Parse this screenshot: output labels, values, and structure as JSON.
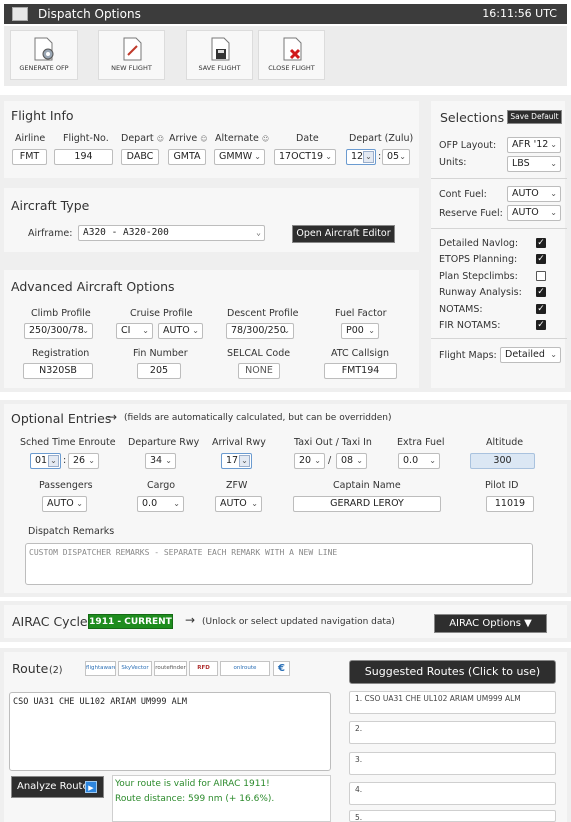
{
  "titlebar": {
    "title": "Dispatch Options",
    "time": "16:11:56 UTC"
  },
  "toolbar": {
    "generate_ofp": "GENERATE OFP",
    "new_flight": "NEW FLIGHT",
    "save_flight": "SAVE FLIGHT",
    "close_flight": "CLOSE FLIGHT"
  },
  "flight_info": {
    "title": "Flight Info",
    "airline_label": "Airline",
    "airline": "FMT",
    "flightno_label": "Flight-No.",
    "flightno": "194",
    "depart_label": "Depart",
    "depart": "DABC",
    "arrive_label": "Arrive",
    "arrive": "GMTA",
    "alternate_label": "Alternate",
    "alternate": "GMMW",
    "date_label": "Date",
    "date": "17OCT19",
    "depzulu_label": "Depart (Zulu)",
    "dep_hour": "12",
    "dep_min": "05",
    "colon": ":"
  },
  "selections": {
    "title": "Selections",
    "save_default": "Save Default",
    "ofp_layout_label": "OFP Layout:",
    "ofp_layout": "AFR '12",
    "units_label": "Units:",
    "units": "LBS",
    "cont_fuel_label": "Cont Fuel:",
    "cont_fuel": "AUTO",
    "reserve_fuel_label": "Reserve Fuel:",
    "reserve_fuel": "AUTO",
    "checks": [
      {
        "label": "Detailed Navlog:",
        "checked": true
      },
      {
        "label": "ETOPS Planning:",
        "checked": true
      },
      {
        "label": "Plan Stepclimbs:",
        "checked": false
      },
      {
        "label": "Runway Analysis:",
        "checked": true
      },
      {
        "label": "NOTAMS:",
        "checked": true
      },
      {
        "label": "FIR NOTAMS:",
        "checked": true
      }
    ],
    "flight_maps_label": "Flight Maps:",
    "flight_maps": "Detailed"
  },
  "aircraft": {
    "title": "Aircraft Type",
    "airframe_label": "Airframe:",
    "airframe": "A320  -  A320-200",
    "editor_button": "Open Aircraft Editor"
  },
  "advanced": {
    "title": "Advanced Aircraft Options",
    "climb_label": "Climb Profile",
    "climb": "250/300/78",
    "cruise_label": "Cruise Profile",
    "cruise_mode": "CI",
    "cruise_value": "AUTO",
    "descent_label": "Descent Profile",
    "descent": "78/300/250",
    "fuel_factor_label": "Fuel Factor",
    "fuel_factor": "P00",
    "registration_label": "Registration",
    "registration": "N320SB",
    "fin_label": "Fin Number",
    "fin": "205",
    "selcal_label": "SELCAL Code",
    "selcal": "NONE",
    "atc_label": "ATC Callsign",
    "atc": "FMT194"
  },
  "optional": {
    "title": "Optional Entries",
    "note": "(fields are automatically calculated, but can be overridden)",
    "sched_label": "Sched Time Enroute",
    "sched_h": "01",
    "sched_m": "26",
    "dep_rwy_label": "Departure Rwy",
    "dep_rwy": "34",
    "arr_rwy_label": "Arrival Rwy",
    "arr_rwy": "17",
    "taxi_label": "Taxi Out / Taxi In",
    "taxi_out": "20",
    "taxi_in": "08",
    "slash": "/",
    "extra_fuel_label": "Extra Fuel",
    "extra_fuel": "0.0",
    "altitude_label": "Altitude",
    "altitude": "300",
    "pax_label": "Passengers",
    "pax": "AUTO",
    "cargo_label": "Cargo",
    "cargo": "0.0",
    "zfw_label": "ZFW",
    "zfw": "AUTO",
    "captain_label": "Captain Name",
    "captain": "GERARD LEROY",
    "pilot_id_label": "Pilot ID",
    "pilot_id": "11019",
    "remarks_label": "Dispatch Remarks",
    "remarks_placeholder": "CUSTOM DISPATCHER REMARKS - SEPARATE EACH REMARK WITH A NEW LINE"
  },
  "airac": {
    "title": "AIRAC Cycle",
    "badge": "1911 - CURRENT",
    "note": "(Unlock or select updated navigation data)",
    "options_button": "AIRAC Options ▼",
    "badge_color": "#1e8c1e"
  },
  "route": {
    "title": "Route",
    "count": "(2)",
    "route_text": "CSO UA31 CHE UL102 ARIAM UM999 ALM",
    "analyze_button": "Analyze Route",
    "valid_line1": "Your route is valid for AIRAC 1911!",
    "valid_line2": "Route distance: 599 nm (+ 16.6%).",
    "suggested_button": "Suggested Routes (Click to use)",
    "suggested": [
      {
        "num": "1.",
        "text": "CSO UA31 CHE UL102 ARIAM UM999 ALM"
      },
      {
        "num": "2.",
        "text": ""
      },
      {
        "num": "3.",
        "text": ""
      },
      {
        "num": "4.",
        "text": ""
      },
      {
        "num": "5.",
        "text": ""
      }
    ],
    "logos": [
      "flightaware",
      "SkyVector",
      "routefinder",
      "RFD",
      "onlroute",
      "e-icon"
    ]
  }
}
